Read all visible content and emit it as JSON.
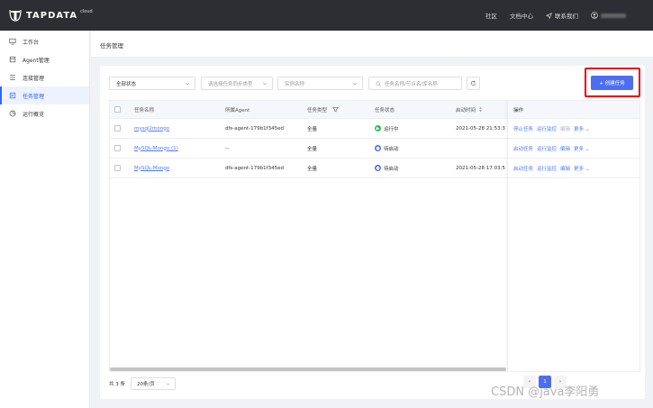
{
  "brand": {
    "name": "TAPDATA",
    "sup": "cloud"
  },
  "topnav": {
    "community": "社区",
    "docs": "文档中心",
    "contact": "联系我们"
  },
  "sidebar": {
    "items": [
      {
        "label": "工作台",
        "icon": "monitor-icon"
      },
      {
        "label": "Agent管理",
        "icon": "agent-icon"
      },
      {
        "label": "连接管理",
        "icon": "connection-icon"
      },
      {
        "label": "任务管理",
        "icon": "task-icon",
        "active": true
      },
      {
        "label": "运行概览",
        "icon": "overview-icon"
      }
    ]
  },
  "page": {
    "title": "任务管理"
  },
  "filters": {
    "status": "全部状态",
    "sync_type_placeholder": "请选择任务同步类型",
    "instance_placeholder": "实例名称",
    "search_placeholder": "任务名称/节点名/库名称"
  },
  "create_button": "+ 创建任务",
  "table": {
    "columns": [
      "任务名称",
      "所属Agent",
      "任务类型",
      "任务状态",
      "启动时间",
      "操作"
    ],
    "rows": [
      {
        "name": "mysql2mongo",
        "agent": "dfs-agent-179b1f345ed",
        "type": "全量",
        "status": "运行中",
        "status_color": "#2ebc4f",
        "start": "2021-05-28 21:53:3",
        "ops": [
          "停止任务",
          "运行监控",
          "编辑",
          "更多"
        ],
        "op_disabled": [
          false,
          false,
          true,
          false
        ]
      },
      {
        "name": "MySQL-Mongo (1)",
        "agent": "--",
        "type": "全量",
        "status": "待启动",
        "status_color": "#4e6ef2",
        "start": "",
        "ops": [
          "启动任务",
          "运行监控",
          "编辑",
          "更多"
        ],
        "op_disabled": [
          false,
          false,
          false,
          false
        ]
      },
      {
        "name": "MySQL-Mongo",
        "agent": "dfs-agent-179b1f345ed",
        "type": "全量",
        "status": "待启动",
        "status_color": "#4e6ef2",
        "start": "2021-05-28 17:03:5",
        "ops": [
          "启动任务",
          "运行监控",
          "编辑",
          "更多"
        ],
        "op_disabled": [
          false,
          false,
          false,
          false
        ]
      }
    ]
  },
  "footer": {
    "total": "共 3 条",
    "page_size": "20条/页",
    "current_page": "1"
  },
  "watermark": "CSDN @java李阳勇"
}
